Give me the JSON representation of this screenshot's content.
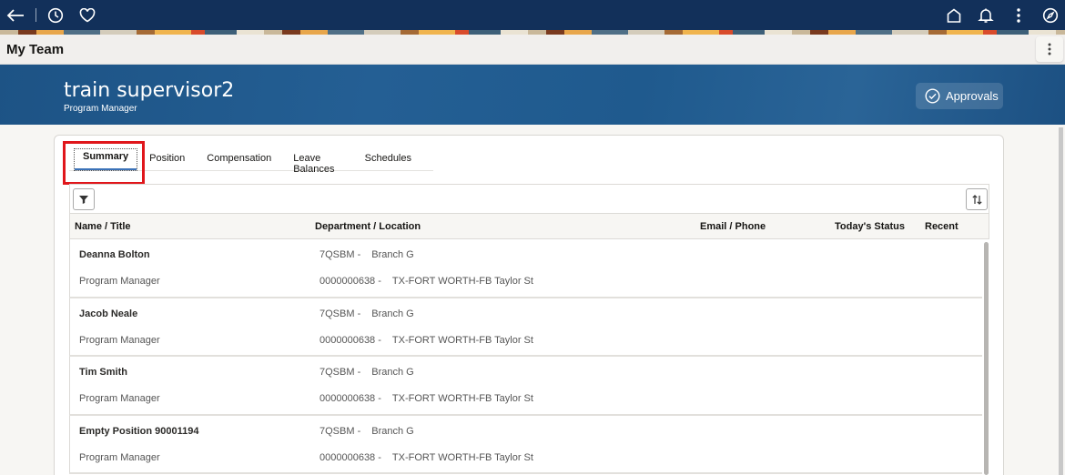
{
  "topbar": {
    "left_icons": [
      "back-arrow-icon",
      "recent-clock-icon",
      "favorites-heart-icon"
    ],
    "right_icons": [
      "home-icon",
      "notifications-bell-icon",
      "actions-kebab-icon",
      "navigator-compass-icon"
    ]
  },
  "titlebar": {
    "title": "My Team"
  },
  "banner": {
    "name": "train supervisor2",
    "role": "Program Manager",
    "approvals_label": "Approvals"
  },
  "tabs": [
    {
      "label": "Summary",
      "active": true
    },
    {
      "label": "Position",
      "active": false
    },
    {
      "label": "Compensation",
      "active": false
    },
    {
      "label": "Leave Balances",
      "active": false
    },
    {
      "label": "Schedules",
      "active": false
    }
  ],
  "table": {
    "columns": [
      "Name / Title",
      "Department / Location",
      "Email / Phone",
      "Today's Status",
      "Recent"
    ],
    "rows": [
      {
        "name": "Deanna Bolton",
        "title": "Program Manager",
        "dept_code": "7QSBM -",
        "dept_name": "Branch G",
        "loc_code": "0000000638 -",
        "loc_name": "TX-FORT WORTH-FB Taylor St"
      },
      {
        "name": "Jacob Neale",
        "title": "Program Manager",
        "dept_code": "7QSBM -",
        "dept_name": "Branch G",
        "loc_code": "0000000638 -",
        "loc_name": "TX-FORT WORTH-FB Taylor St"
      },
      {
        "name": "Tim Smith",
        "title": "Program Manager",
        "dept_code": "7QSBM -",
        "dept_name": "Branch G",
        "loc_code": "0000000638 -",
        "loc_name": "TX-FORT WORTH-FB Taylor St"
      },
      {
        "name": "Empty Position 90001194",
        "title": "Program Manager",
        "dept_code": "7QSBM -",
        "dept_name": "Branch G",
        "loc_code": "0000000638 -",
        "loc_name": "TX-FORT WORTH-FB Taylor St"
      }
    ]
  },
  "colors": {
    "topbar": "#12305a",
    "banner": "#245f94",
    "highlight": "#e0161b",
    "active_tab_underline": "#3b72b8"
  }
}
